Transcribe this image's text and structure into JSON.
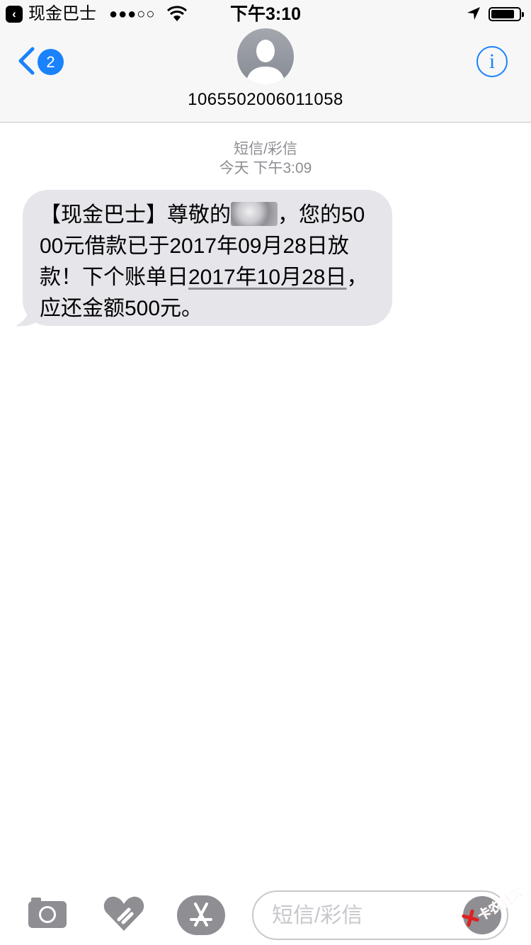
{
  "status_bar": {
    "back_app": "现金巴士",
    "signal": "●●●○○",
    "time": "下午3:10"
  },
  "nav": {
    "badge_count": "2",
    "contact": "1065502006011058",
    "info_icon": "i",
    "accent": "#1a82fb"
  },
  "thread": {
    "message_type": "短信/彩信",
    "timestamp": "今天 下午3:09",
    "message": {
      "prefix": "【现金巴士】尊敬的",
      "after_name": "，您的5000元借款已于2017年09月28日放款！下个账单日",
      "due_date": "2017年10月28日",
      "suffix": "，应还金额500元。"
    }
  },
  "composer": {
    "placeholder": "短信/彩信",
    "icons": [
      "camera-icon",
      "digital-touch-icon",
      "app-store-icon",
      "send-icon"
    ]
  },
  "watermark": {
    "text": "卡农社区"
  }
}
